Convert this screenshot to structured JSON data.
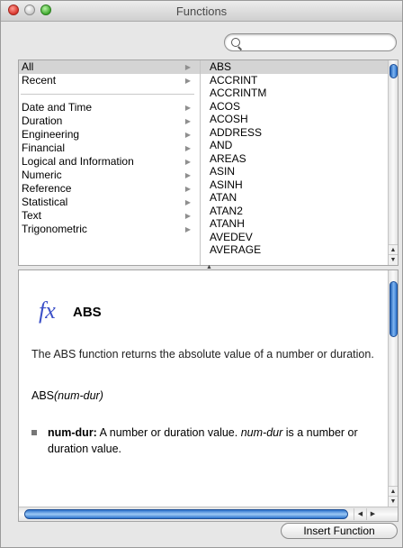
{
  "window": {
    "title": "Functions"
  },
  "search": {
    "placeholder": "",
    "value": ""
  },
  "categories": [
    {
      "label": "All",
      "selected": true
    },
    {
      "label": "Recent"
    },
    {
      "label": "Date and Time"
    },
    {
      "label": "Duration"
    },
    {
      "label": "Engineering"
    },
    {
      "label": "Financial"
    },
    {
      "label": "Logical and Information"
    },
    {
      "label": "Numeric"
    },
    {
      "label": "Reference"
    },
    {
      "label": "Statistical"
    },
    {
      "label": "Text"
    },
    {
      "label": "Trigonometric"
    }
  ],
  "functions": [
    "ABS",
    "ACCRINT",
    "ACCRINTM",
    "ACOS",
    "ACOSH",
    "ADDRESS",
    "AND",
    "AREAS",
    "ASIN",
    "ASINH",
    "ATAN",
    "ATAN2",
    "ATANH",
    "AVEDEV",
    "AVERAGE"
  ],
  "selected_function": "ABS",
  "detail": {
    "fx_symbol": "fx",
    "name": "ABS",
    "description": "The ABS function returns the absolute value of a number or duration.",
    "syntax_name": "ABS",
    "syntax_args": "(num-dur)",
    "arg_name": "num-dur:",
    "arg_desc_prefix": "A number or duration value.",
    "arg_desc_italic": "num-dur",
    "arg_desc_suffix": "is a number or duration value."
  },
  "buttons": {
    "insert": "Insert Function"
  },
  "icons": {
    "close": "close-icon",
    "minimize": "minimize-icon",
    "zoom": "zoom-icon",
    "search": "search-icon",
    "disclosure": "chevron-right-icon"
  }
}
